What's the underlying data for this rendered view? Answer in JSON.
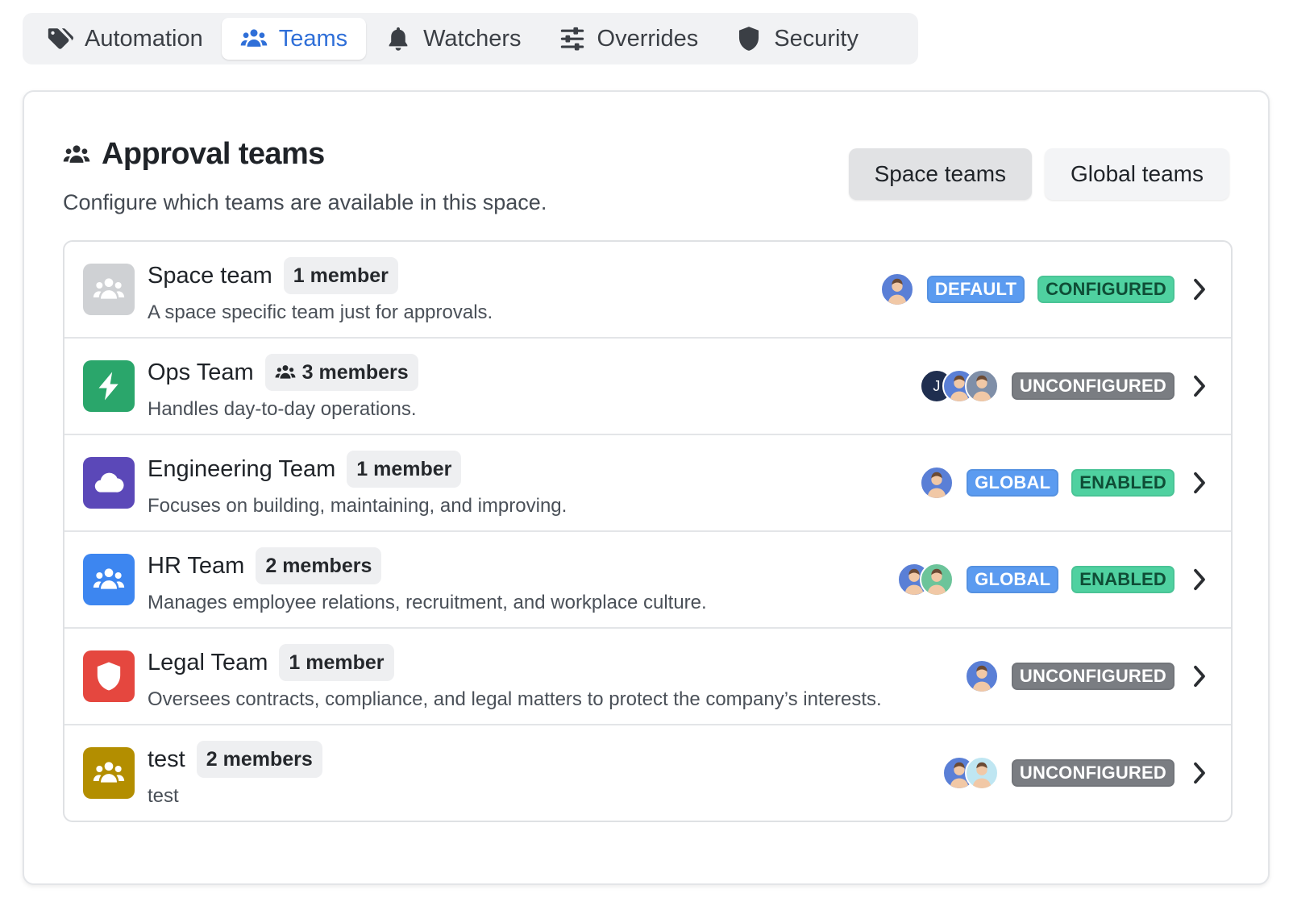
{
  "tabs": [
    {
      "label": "Automation",
      "icon": "tag-icon",
      "active": false
    },
    {
      "label": "Teams",
      "icon": "people-icon",
      "active": true
    },
    {
      "label": "Watchers",
      "icon": "bell-icon",
      "active": false
    },
    {
      "label": "Overrides",
      "icon": "sliders-icon",
      "active": false
    },
    {
      "label": "Security",
      "icon": "shield-icon",
      "active": false
    }
  ],
  "card": {
    "title": "Approval teams",
    "subtitle": "Configure which teams are available in this space.",
    "segment": {
      "space_label": "Space teams",
      "global_label": "Global teams",
      "active": "space"
    }
  },
  "teams": [
    {
      "name": "Space team",
      "members": "1 member",
      "members_icon": false,
      "description": "A space specific team just for approvals.",
      "icon": "people-icon",
      "icon_color": "#cfd1d4",
      "avatars": [
        "#5a7fd6"
      ],
      "badges": [
        {
          "text": "DEFAULT",
          "style": "blue"
        },
        {
          "text": "CONFIGURED",
          "style": "green"
        }
      ]
    },
    {
      "name": "Ops Team",
      "members": "3 members",
      "members_icon": true,
      "description": "Handles day-to-day operations.",
      "icon": "lightning-icon",
      "icon_color": "#2aa66b",
      "avatars": [
        "J",
        "#5a7fd6",
        "#7f8fa8"
      ],
      "badges": [
        {
          "text": "UNCONFIGURED",
          "style": "gray"
        }
      ]
    },
    {
      "name": "Engineering Team",
      "members": "1 member",
      "members_icon": false,
      "description": "Focuses on building, maintaining, and improving.",
      "icon": "cloud-icon",
      "icon_color": "#5b48b8",
      "avatars": [
        "#5a7fd6"
      ],
      "badges": [
        {
          "text": "GLOBAL",
          "style": "blue"
        },
        {
          "text": "ENABLED",
          "style": "green"
        }
      ]
    },
    {
      "name": "HR Team",
      "members": "2 members",
      "members_icon": false,
      "description": "Manages employee relations, recruitment, and workplace culture.",
      "icon": "people-icon",
      "icon_color": "#3d86f0",
      "avatars": [
        "#5a7fd6",
        "#6cc49a"
      ],
      "badges": [
        {
          "text": "GLOBAL",
          "style": "blue"
        },
        {
          "text": "ENABLED",
          "style": "green"
        }
      ]
    },
    {
      "name": "Legal Team",
      "members": "1 member",
      "members_icon": false,
      "description": "Oversees contracts, compliance, and legal matters to protect the company’s interests.",
      "icon": "shield-icon",
      "icon_color": "#e5473f",
      "avatars": [
        "#5a7fd6"
      ],
      "badges": [
        {
          "text": "UNCONFIGURED",
          "style": "gray"
        }
      ]
    },
    {
      "name": "test",
      "members": "2 members",
      "members_icon": false,
      "description": "test",
      "icon": "people-icon",
      "icon_color": "#b38e00",
      "avatars": [
        "#5a7fd6",
        "#bfe6f2"
      ],
      "badges": [
        {
          "text": "UNCONFIGURED",
          "style": "gray"
        }
      ]
    }
  ]
}
